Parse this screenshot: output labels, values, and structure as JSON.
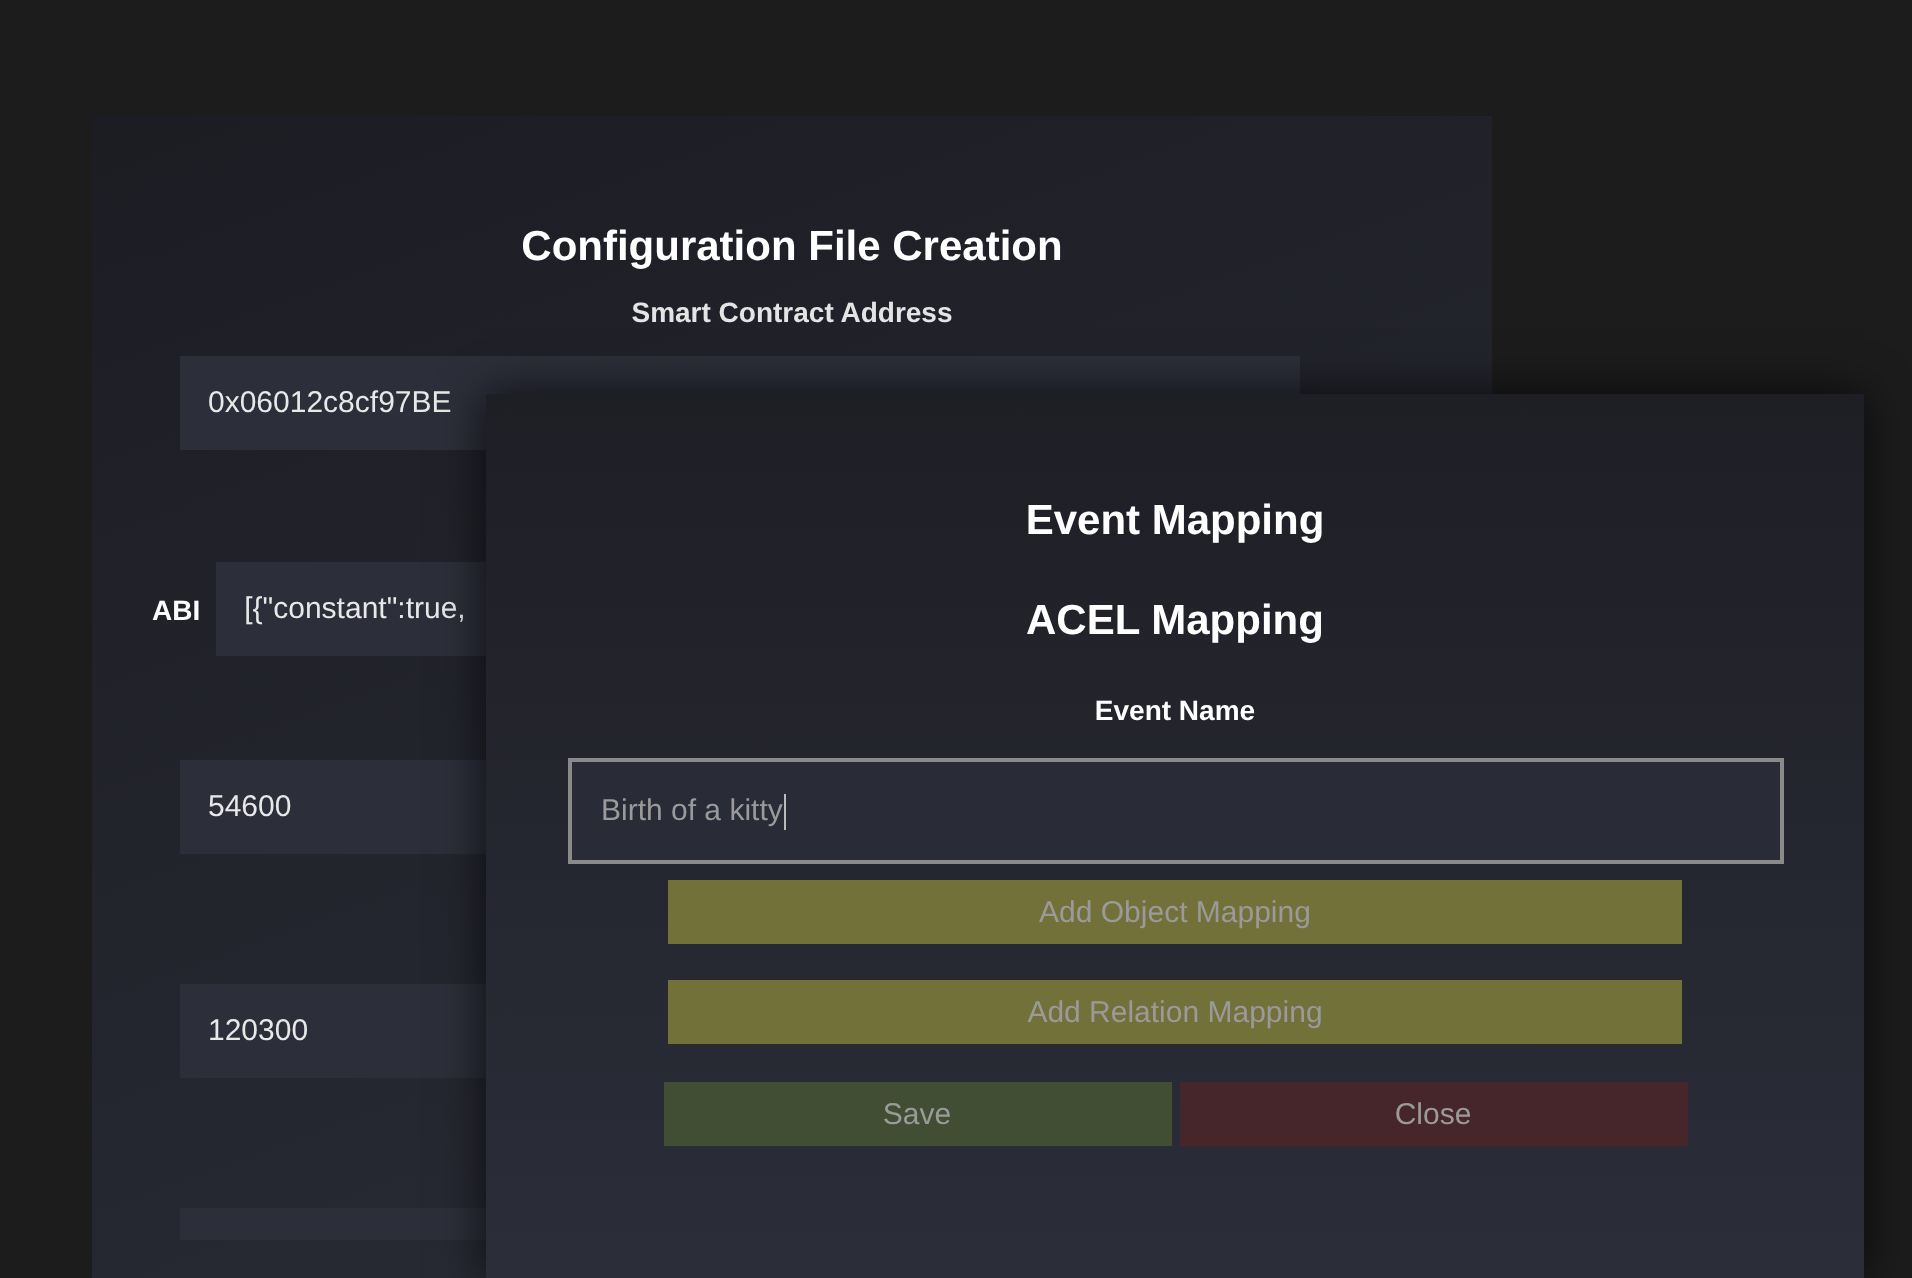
{
  "config_window": {
    "title": "Configuration File Creation",
    "address_label": "Smart Contract Address",
    "fields": [
      {
        "value": "0x06012c8cf97BE"
      },
      {
        "label": "ABI",
        "value": "[{\"constant\":true,"
      },
      {
        "value": "54600"
      },
      {
        "value": "120300"
      }
    ]
  },
  "mapping_dialog": {
    "title": "Event Mapping",
    "subtitle": "ACEL Mapping",
    "event_name_label": "Event Name",
    "event_name": {
      "value": "Birth of a kitty",
      "focused": true
    },
    "buttons": [
      {
        "kind": "add",
        "label": "Add Object Mapping"
      },
      {
        "kind": "add",
        "label": "Add Relation Mapping"
      },
      {
        "kind": "save",
        "label": "Save"
      },
      {
        "kind": "close",
        "label": "Close"
      }
    ]
  }
}
